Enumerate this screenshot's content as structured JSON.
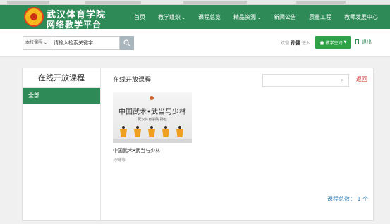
{
  "header": {
    "site_title_line1": "武汉体育学院",
    "site_title_line2": "网络教学平台",
    "nav": [
      {
        "label": "首页",
        "has_dropdown": false
      },
      {
        "label": "教学组织",
        "has_dropdown": true
      },
      {
        "label": "课程总览",
        "has_dropdown": false
      },
      {
        "label": "精品资源",
        "has_dropdown": true
      },
      {
        "label": "新闻公告",
        "has_dropdown": false
      },
      {
        "label": "质量工程",
        "has_dropdown": false
      },
      {
        "label": "教师发展中心",
        "has_dropdown": false
      }
    ],
    "chevron": "⌄"
  },
  "search": {
    "scope": "本校课程",
    "input_value": "请输入检索关键字"
  },
  "user": {
    "welcome_prefix": "欢迎",
    "name": "孙健",
    "welcome_suffix": "进入",
    "space_button": "教学空间",
    "exit": "退出"
  },
  "sidebar": {
    "title": "在线开放课程",
    "active_item": "全部"
  },
  "content": {
    "title": "在线开放课程",
    "back": "返回",
    "courses": [
      {
        "image_title": "中国武术•武当与少林",
        "image_subtitle": "武汉体育学院 孙健",
        "name": "中国武术•武当与少林",
        "teacher": "孙健等"
      }
    ],
    "total": "课程总数： 1 个"
  },
  "colors": {
    "brand_green": "#2e8b57",
    "button_green": "#2fa247",
    "back_red": "#d0342c",
    "total_blue": "#2e7fb8"
  }
}
